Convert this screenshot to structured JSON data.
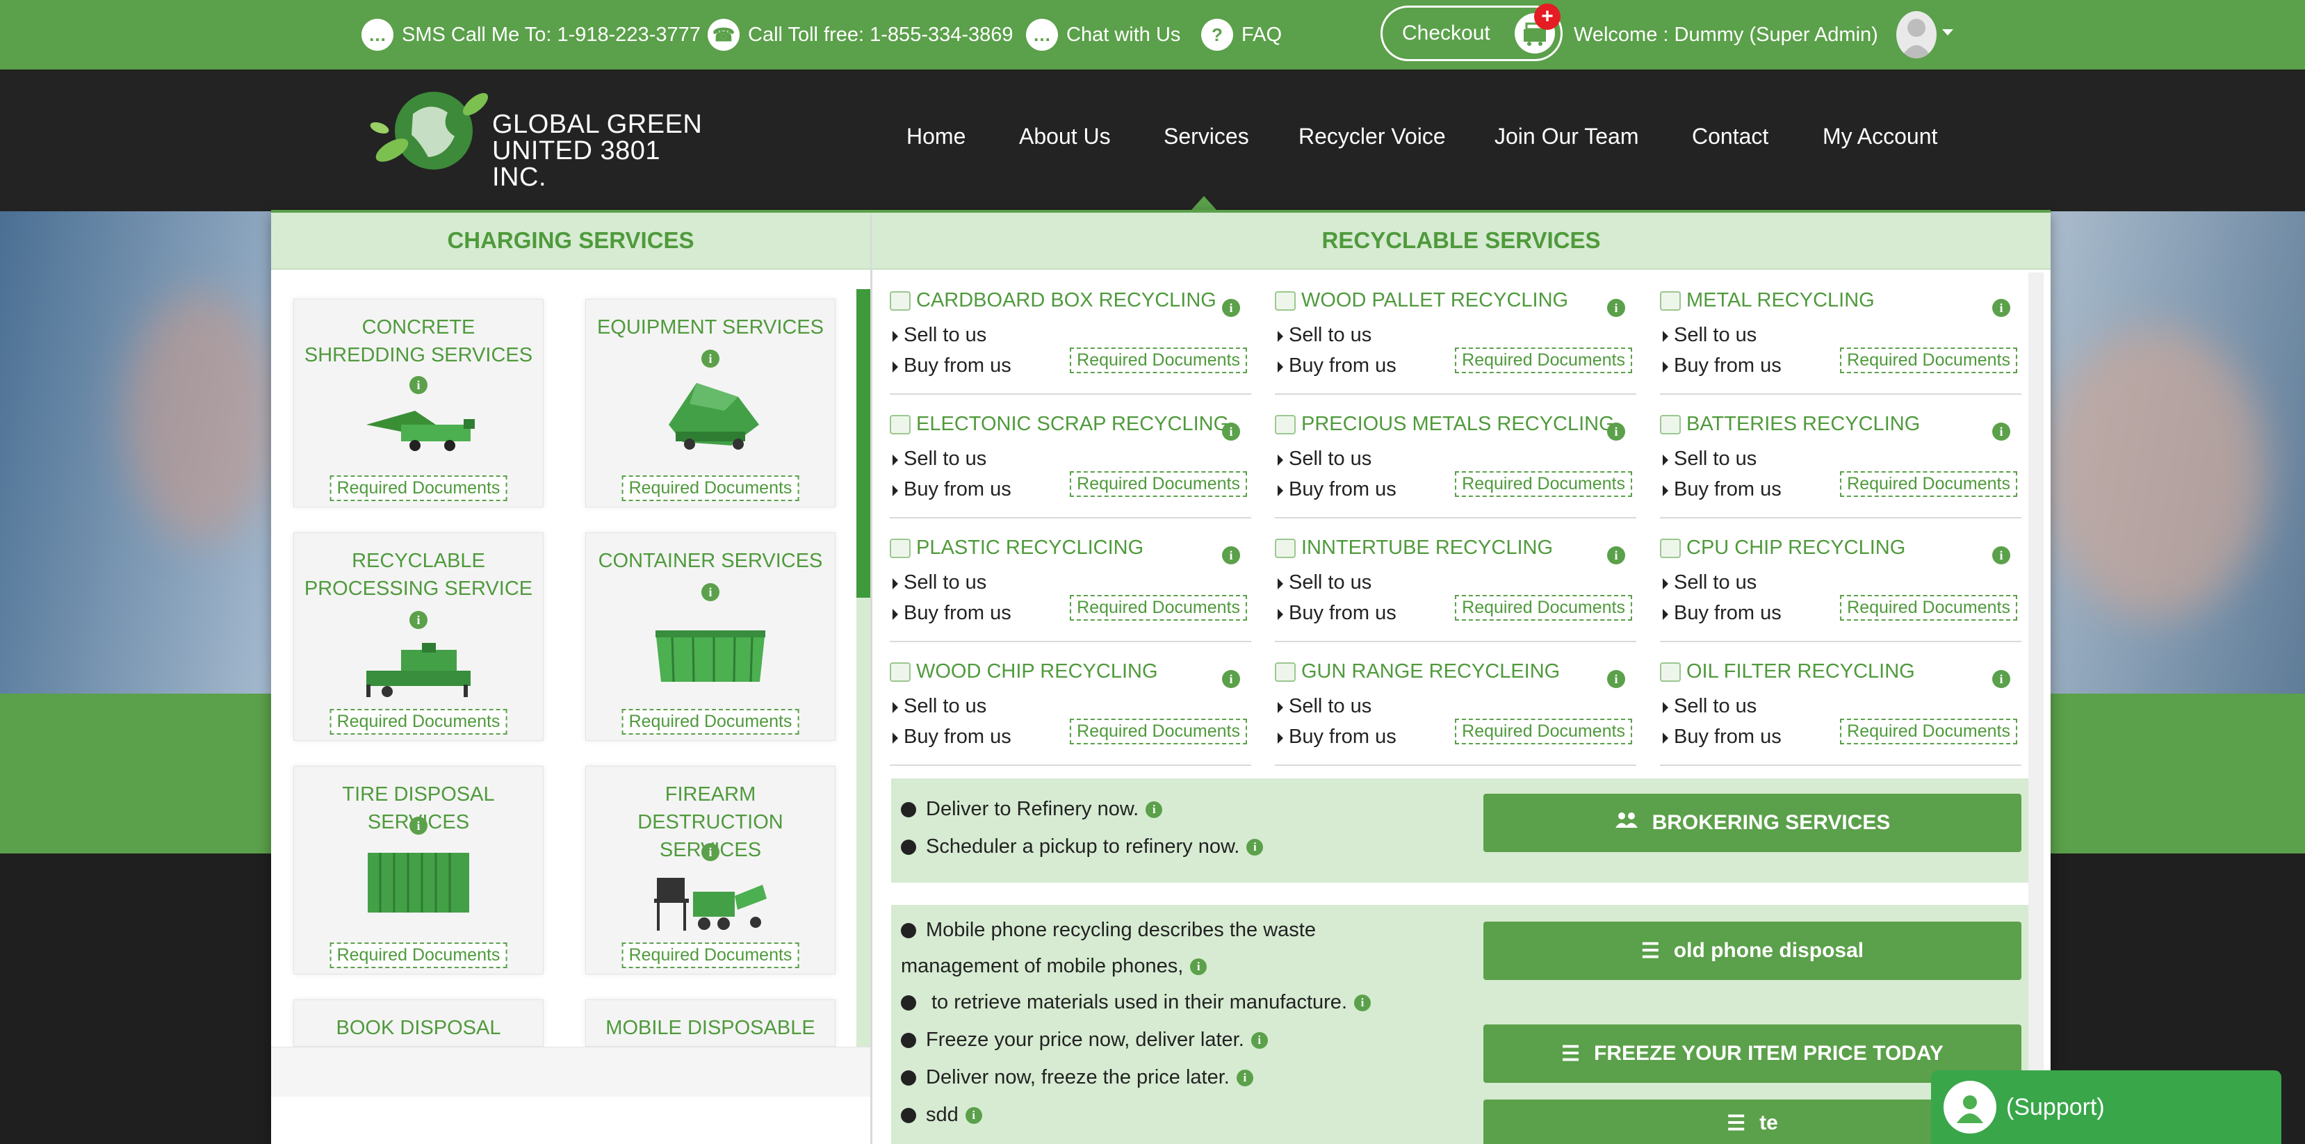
{
  "topbar": {
    "sms": "SMS Call Me To: 1-918-223-3777",
    "tollfree": "Call Toll free: 1-855-334-3869",
    "chat": "Chat with Us",
    "faq": "FAQ",
    "checkout": "Checkout",
    "cart_badge": "+",
    "welcome": "Welcome : Dummy (Super Admin)"
  },
  "logo": {
    "line1": "GLOBAL GREEN",
    "line2": "UNITED 3801 INC."
  },
  "nav": {
    "items": [
      "Home",
      "About Us",
      "Services",
      "Recycler Voice",
      "Join Our Team",
      "Contact",
      "My Account"
    ],
    "active": "Services"
  },
  "charging": {
    "heading": "CHARGING SERVICES",
    "required_label": "Required Documents",
    "cards": [
      {
        "title": "CONCRETE SHREDDING SERVICES",
        "icon": "shredder-machine-icon"
      },
      {
        "title": "EQUIPMENT SERVICES",
        "icon": "equipment-machine-icon"
      },
      {
        "title": "RECYCLABLE PROCESSING SERVICE",
        "icon": "baler-machine-icon"
      },
      {
        "title": "CONTAINER SERVICES",
        "icon": "dumpster-icon"
      },
      {
        "title": "TIRE DISPOSAL SERVICES",
        "icon": "shipping-container-icon"
      },
      {
        "title": "FIREARM DESTRUCTION SERVICES",
        "icon": "firearm-shredder-icon"
      },
      {
        "title": "BOOK DISPOSAL",
        "icon": ""
      },
      {
        "title": "MOBILE DISPOSABLE",
        "icon": ""
      }
    ]
  },
  "recyclable": {
    "heading": "RECYCLABLE SERVICES",
    "sell_label": "Sell to us",
    "buy_label": "Buy from us",
    "required_label": "Required Documents",
    "items": [
      {
        "title": "CARDBOARD BOX RECYCLING",
        "icon": "box-icon"
      },
      {
        "title": "WOOD PALLET RECYCLING",
        "icon": "pallet-icon"
      },
      {
        "title": "METAL RECYCLING",
        "icon": "metal-icon"
      },
      {
        "title": "ELECTONIC SCRAP RECYCLING",
        "icon": "circuit-icon"
      },
      {
        "title": "PRECIOUS METALS RECYCLING",
        "icon": "gold-icon"
      },
      {
        "title": "BATTERIES RECYCLING",
        "icon": "battery-icon"
      },
      {
        "title": "PLASTIC RECYCLICING",
        "icon": "bottle-icon"
      },
      {
        "title": "INNTERTUBE RECYCLING",
        "icon": "tube-icon"
      },
      {
        "title": "CPU CHIP RECYCLING",
        "icon": "chip-icon"
      },
      {
        "title": "WOOD CHIP RECYCLING",
        "icon": "woodchip-icon"
      },
      {
        "title": "GUN RANGE RECYCLEING",
        "icon": "range-icon"
      },
      {
        "title": "OIL FILTER RECYCLING",
        "icon": "filter-icon"
      }
    ]
  },
  "brokering": {
    "bullets": [
      "Deliver to Refinery now.",
      "Scheduler a pickup to refinery now."
    ],
    "button": "BROKERING SERVICES"
  },
  "phone": {
    "bullet1_a": "Mobile phone recycling describes the waste",
    "bullet1_b": "management of mobile phones,",
    "bullet2": "to retrieve materials used in their manufacture.",
    "bullet3": "Freeze your price now, deliver later.",
    "bullet4": "Deliver now, freeze the price later.",
    "bullet5": "sdd",
    "btn_old_phone": "old phone disposal",
    "btn_freeze": "FREEZE YOUR ITEM PRICE TODAY",
    "btn_te": "te"
  },
  "support": {
    "label": "(Support)"
  },
  "colors": {
    "brand_green": "#5ba04a",
    "light_green": "#d6ebd2",
    "dark_nav": "#232323",
    "badge_red": "#e41c23"
  }
}
